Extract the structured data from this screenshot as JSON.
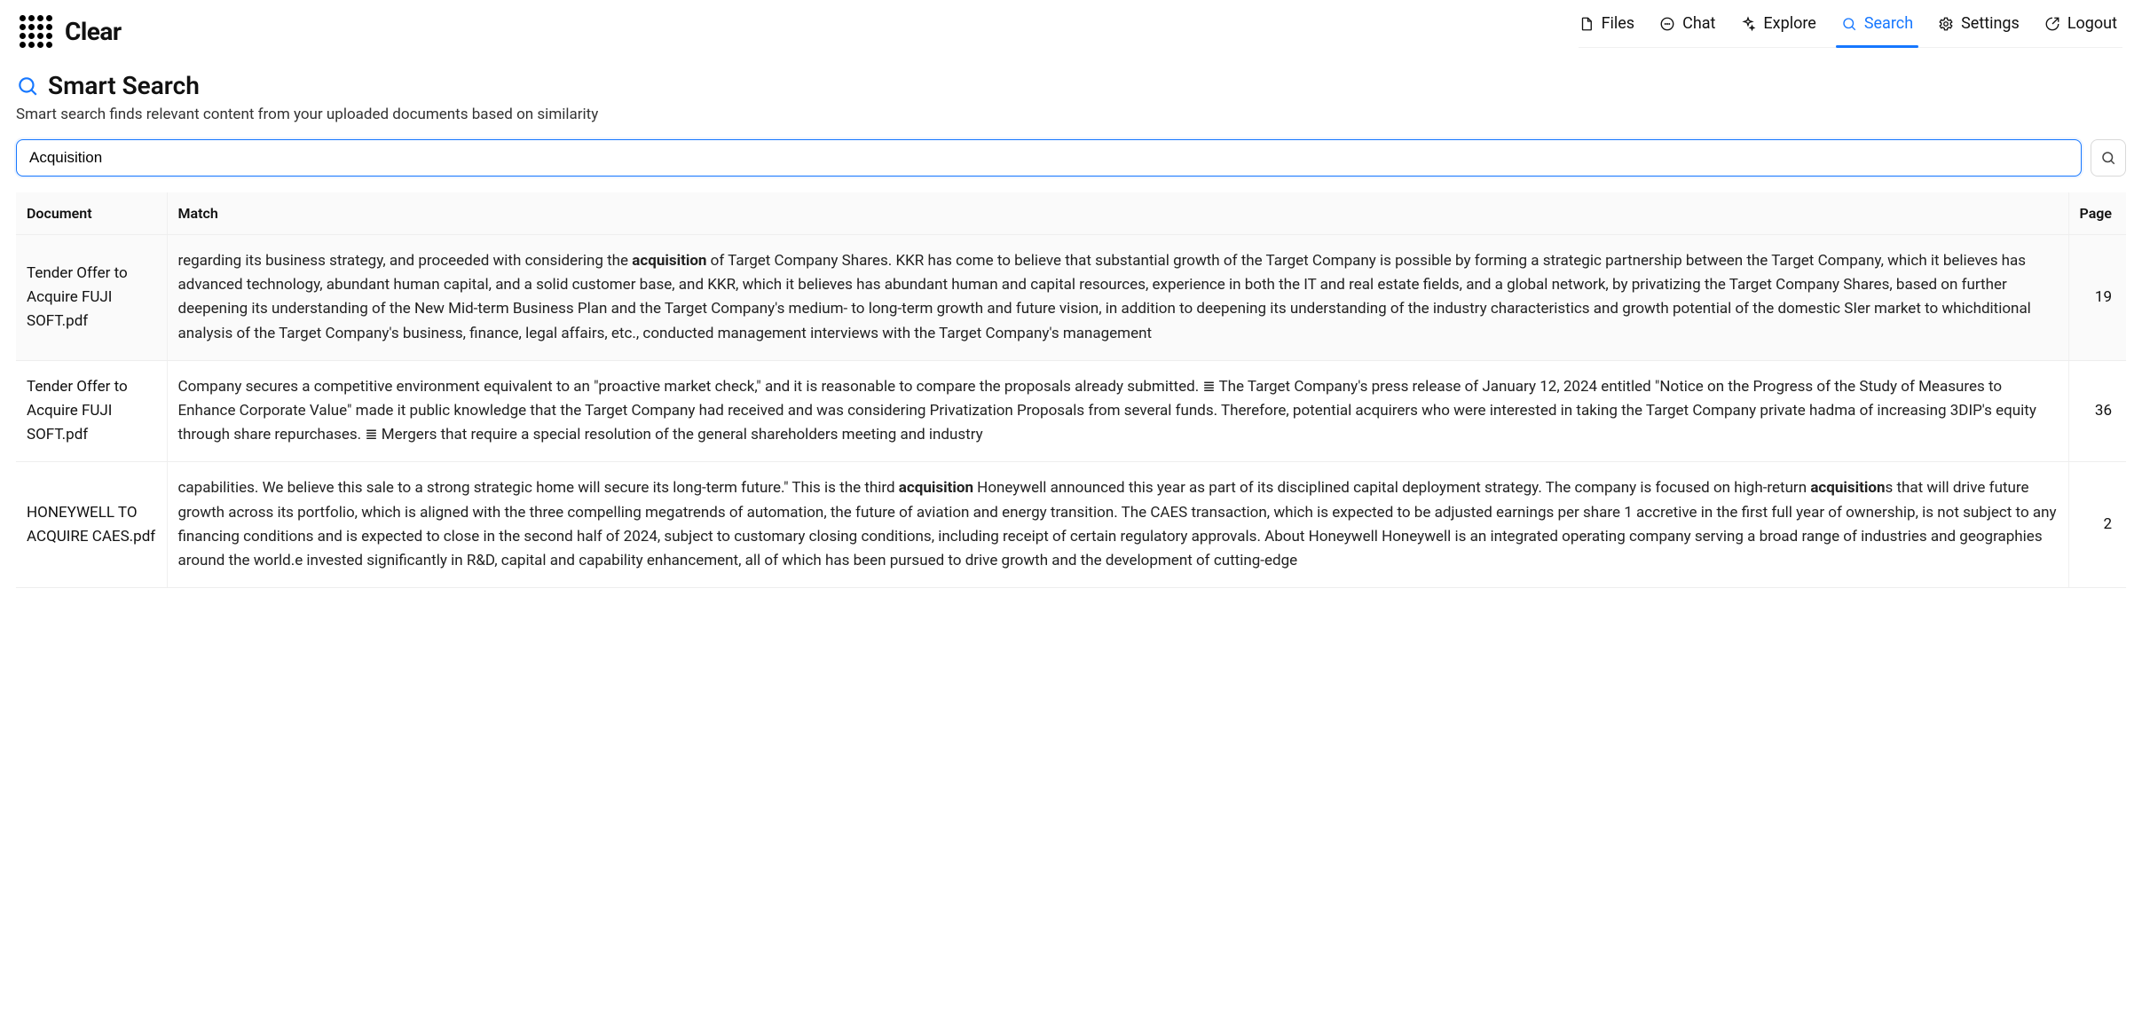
{
  "brand": {
    "name": "Clear"
  },
  "nav": {
    "files": {
      "label": "Files"
    },
    "chat": {
      "label": "Chat"
    },
    "explore": {
      "label": "Explore"
    },
    "search": {
      "label": "Search",
      "active": true
    },
    "settings": {
      "label": "Settings"
    },
    "logout": {
      "label": "Logout"
    }
  },
  "page": {
    "title": "Smart Search",
    "subtitle": "Smart search finds relevant content from your uploaded documents based on similarity"
  },
  "search": {
    "value": "Acquisition"
  },
  "table": {
    "headers": {
      "document": "Document",
      "match": "Match",
      "page": "Page"
    }
  },
  "results": [
    {
      "document": "Tender Offer to Acquire FUJI SOFT.pdf",
      "match_html": "regarding its business strategy, and proceeded with considering the <b>acquisition</b> of Target Company Shares. KKR has come to believe that substantial growth of the Target Company is possible by forming a strategic partnership between the Target Company, which it believes has advanced technology, abundant human capital, and a solid customer base, and KKR, which it believes has abundant human and capital resources, experience in both the IT and real estate fields, and a global network, by privatizing the Target Company Shares, based on further deepening its understanding of the New Mid-term Business Plan and the Target Company's medium- to long-term growth and future vision, in addition to deepening its understanding of the industry characteristics and growth potential of the domestic SIer market to whichditional analysis of the Target Company's business, finance, legal affairs, etc., conducted management interviews with the Target Company's management",
      "page": 19
    },
    {
      "document": "Tender Offer to Acquire FUJI SOFT.pdf",
      "match_html": "Company secures a competitive environment equivalent to an \"proactive market check,\" and it is reasonable to compare the proposals already submitted. ≣ The Target Company's press release of January 12, 2024 entitled \"Notice on the Progress of the Study of Measures to Enhance Corporate Value\" made it public knowledge that the Target Company had received and was considering Privatization Proposals from several funds. Therefore, potential acquirers who were interested in taking the Target Company private hadma of increasing 3DIP's equity through share repurchases. ≣ Mergers that require a special resolution of the general shareholders meeting and industry",
      "page": 36
    },
    {
      "document": "HONEYWELL TO ACQUIRE CAES.pdf",
      "match_html": "capabilities. We believe this sale to a strong strategic home will secure its long-term future.\" This is the third <b>acquisition</b> Honeywell announced this year as part of its disciplined capital deployment strategy. The company is focused on high-return <b>acquisition</b>s that will drive future growth across its portfolio, which is aligned with the three compelling megatrends of automation, the future of aviation and energy transition. The CAES transaction, which is expected to be adjusted earnings per share 1 accretive in the first full year of ownership, is not subject to any financing conditions and is expected to close in the second half of 2024, subject to customary closing conditions, including receipt of certain regulatory approvals. About Honeywell Honeywell is an integrated operating company serving a broad range of industries and geographies around the world.e invested significantly in R&D, capital and capability enhancement, all of which has been pursued to drive growth and the development of cutting-edge",
      "page": 2
    }
  ]
}
